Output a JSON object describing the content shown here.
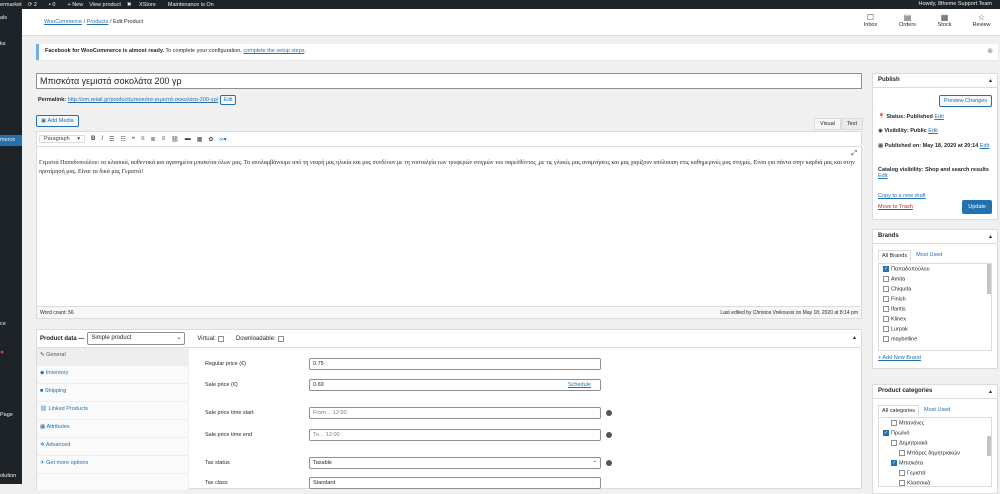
{
  "adminbar": {
    "site": "ermarket",
    "updates": "2",
    "comments": "0",
    "new": "+ New",
    "view": "View product",
    "xstore": "XStore",
    "maintenance": "Maintenance is On",
    "howdy": "Howdy, 8theme Support Team"
  },
  "sidebar": {
    "items": [
      "als",
      "ks",
      "merce",
      "ce",
      "Page",
      "olution"
    ]
  },
  "breadcrumb": {
    "woo": "WooCommerce",
    "sep1": "/",
    "products": "Products",
    "sep2": "/",
    "current": "Edit Product"
  },
  "header_icons": [
    {
      "icon": "inbox-icon",
      "glyph": "☐",
      "label": "Inbox"
    },
    {
      "icon": "orders-icon",
      "glyph": "▤",
      "label": "Orders"
    },
    {
      "icon": "stock-icon",
      "glyph": "▦",
      "label": "Stock"
    },
    {
      "icon": "reviews-icon",
      "glyph": "☆",
      "label": "Review"
    }
  ],
  "notice": {
    "bold": "Facebook for WooCommerce is almost ready.",
    "text": " To complete your configuration, ",
    "link": "complete the setup steps",
    "end": ".",
    "close": "⊗"
  },
  "product": {
    "title": "Μπισκότα γεμιστά σοκολάτα 200 γρ",
    "permalink_label": "Permalink:",
    "permalink_url": "http://om.retail.gr/product/μπισκότα-γεμιστά-σοκολάτα-200-γρ/",
    "edit_label": "Edit"
  },
  "editor": {
    "add_media": "Add Media",
    "tab_visual": "Visual",
    "tab_text": "Text",
    "format": "Paragraph",
    "content": "Γεμιστά Παπαδοπούλου: τα κλασικά, αυθεντικά και αγαπημένα μπισκότα όλων μας. Τα απολαμβάνουμε από τη νεαρή μας ηλικία και μας συνδέουν με τη νοσταλγία των τρυφερών στιγμών του παρελθόντος ,με τις γλυκές μας αναμνήσεις και μας χαρίζουν απόλαυση στις καθημερινές μας στιγμές. Είναι για πάντα στην καρδιά μας και στην προτίμησή μας. Είναι τα δικά μας Γεμιστά!",
    "word_count": "Word count: 56",
    "last_edited": "Last edited by Christos Vrekousis on May 18, 2020 at 8:14 pm"
  },
  "product_data": {
    "label": "Product data —",
    "type": "Simple product",
    "virtual": "Virtual:",
    "downloadable": "Downloadable:",
    "nav": [
      "General",
      "Inventory",
      "Shipping",
      "Linked Products",
      "Attributes",
      "Advanced",
      "Get more options"
    ],
    "regular_price_label": "Regular price (€)",
    "regular_price": "0.75",
    "sale_price_label": "Sale price (€)",
    "sale_price": "0.69",
    "schedule": "Schedule",
    "start_label": "Sale price time start",
    "start_placeholder": "From… 12:00",
    "end_label": "Sale price time end",
    "end_placeholder": "To… 12:00",
    "tax_status_label": "Tax status",
    "tax_status": "Taxable",
    "tax_class_label": "Tax class",
    "tax_class": "Standard"
  },
  "publish": {
    "title": "Publish",
    "preview": "Preview Changes",
    "status": "Status: Published",
    "visibility": "Visibility: Public",
    "published_on": "Published on: May 18, 2020 at 20:14",
    "catalog": "Catalog visibility: Shop and search results",
    "edit": "Edit",
    "copy": "Copy to a new draft",
    "trash": "Move to Trash",
    "update": "Update"
  },
  "brands": {
    "title": "Brands",
    "tab_all": "All Brands",
    "tab_used": "Most Used",
    "items": [
      {
        "name": "Παπαδοπούλου",
        "checked": true
      },
      {
        "name": "Amita",
        "checked": false
      },
      {
        "name": "Chiquita",
        "checked": false
      },
      {
        "name": "Finish",
        "checked": false
      },
      {
        "name": "Ifantis",
        "checked": false
      },
      {
        "name": "Klinex",
        "checked": false
      },
      {
        "name": "Lurpak",
        "checked": false
      },
      {
        "name": "maybelline",
        "checked": false
      }
    ],
    "add_new": "+ Add New Brand"
  },
  "categories": {
    "title": "Product categories",
    "tab_all": "All categories",
    "tab_used": "Most Used",
    "items": [
      {
        "name": "Μπανάνες",
        "checked": false,
        "level": 1
      },
      {
        "name": "Πρωϊνό",
        "checked": true,
        "level": 0
      },
      {
        "name": "Δημητριακά",
        "checked": false,
        "level": 1
      },
      {
        "name": "Μπάρες δημητριακών",
        "checked": false,
        "level": 2
      },
      {
        "name": "Μπισκότα",
        "checked": true,
        "level": 1
      },
      {
        "name": "Γεμιστά",
        "checked": false,
        "level": 2
      },
      {
        "name": "Κλασσικά",
        "checked": false,
        "level": 2
      }
    ]
  }
}
